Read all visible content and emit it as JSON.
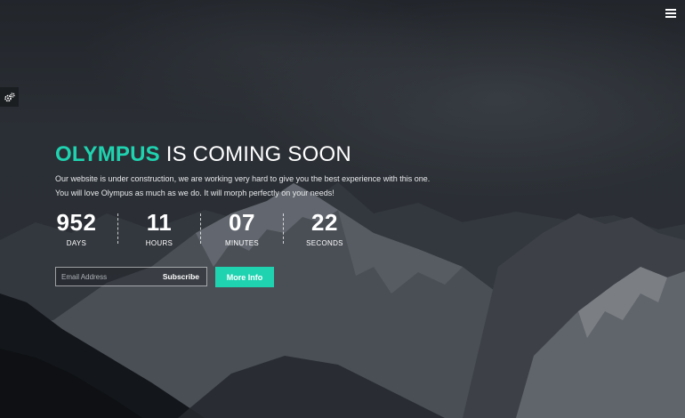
{
  "header": {
    "menu_icon": "hamburger-menu-icon"
  },
  "sidebar": {
    "settings_icon": "gears-icon"
  },
  "hero": {
    "brand": "OLYMPUS",
    "title_rest": " IS COMING SOON",
    "description_line1": "Our website is under construction, we are working very hard to give you the best experience with this one.",
    "description_line2": "You will love Olympus as much as we do. It will morph perfectly on your needs!"
  },
  "countdown": [
    {
      "value": "952",
      "label": "DAYS"
    },
    {
      "value": "11",
      "label": "HOURS"
    },
    {
      "value": "07",
      "label": "MINUTES"
    },
    {
      "value": "22",
      "label": "SECONDS"
    }
  ],
  "subscribe": {
    "placeholder": "Email Address",
    "value": "",
    "button_label": "Subscribe"
  },
  "more_info": {
    "label": "More Info"
  },
  "colors": {
    "accent": "#1fd3b0",
    "background": "#2a2e33",
    "settings_tab": "#1b1e21"
  }
}
